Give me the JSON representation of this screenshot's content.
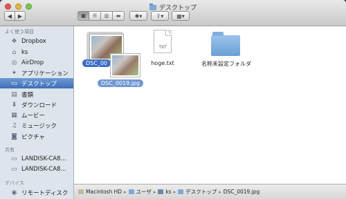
{
  "window": {
    "title": "デスクトップ"
  },
  "toolbar": {
    "back": "◀",
    "forward": "▶",
    "view_modes": [
      "▦",
      "☰",
      "▥",
      "▬"
    ],
    "action_label": "✱▾",
    "share_label": "⇪▾",
    "arrange_label": "▦▾"
  },
  "sidebar": {
    "favorites_header": "よく使う項目",
    "shared_header": "共有",
    "devices_header": "デバイス",
    "favorites": [
      {
        "label": "Dropbox",
        "icon": "dropbox-icon"
      },
      {
        "label": "ks",
        "icon": "home-icon"
      },
      {
        "label": "AirDrop",
        "icon": "airdrop-icon"
      },
      {
        "label": "アプリケーション",
        "icon": "applications-icon"
      },
      {
        "label": "デスクトップ",
        "icon": "desktop-icon",
        "selected": true
      },
      {
        "label": "書類",
        "icon": "documents-icon"
      },
      {
        "label": "ダウンロード",
        "icon": "downloads-icon"
      },
      {
        "label": "ムービー",
        "icon": "movies-icon"
      },
      {
        "label": "ミュージック",
        "icon": "music-icon"
      },
      {
        "label": "ピクチャ",
        "icon": "pictures-icon"
      }
    ],
    "shared": [
      {
        "label": "LANDISK-CA8...",
        "icon": "network-drive-icon"
      },
      {
        "label": "LANDISK-CA8...",
        "icon": "network-drive-icon"
      }
    ],
    "devices": [
      {
        "label": "リモートディスク",
        "icon": "remote-disc-icon"
      }
    ]
  },
  "files": [
    {
      "name": "DSC_0019.jpg",
      "short": "DSC_00",
      "selected": true
    },
    {
      "name": "hoge.txt",
      "badge": "TXT"
    },
    {
      "name": "名称未設定フォルダ"
    }
  ],
  "drag": {
    "label": "DSC_0019.jpg"
  },
  "pathbar": [
    "Macintosh HD",
    "ユーザ",
    "ks",
    "デスクトップ",
    "DSC_0019.jpg"
  ],
  "colors": {
    "selection": "#3c6cc4",
    "sidebar": "#dde4ec"
  }
}
